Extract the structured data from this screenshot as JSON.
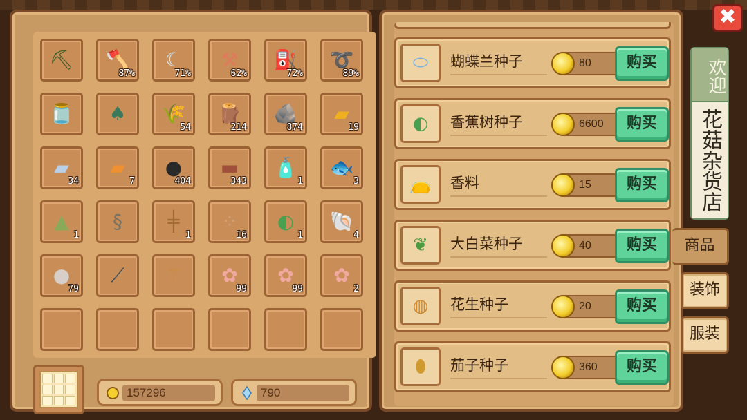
{
  "inventory": {
    "slots": [
      {
        "icon": "pickaxe-icon",
        "glyph": "⛏",
        "color": "#3b5a2a",
        "count": ""
      },
      {
        "icon": "axe-icon",
        "glyph": "🪓",
        "color": "#e07030",
        "count": "87%"
      },
      {
        "icon": "sickle-icon",
        "glyph": "☾",
        "color": "#d8e6f0",
        "count": "71%"
      },
      {
        "icon": "hoe-icon",
        "glyph": "⚒",
        "color": "#e07a5a",
        "count": "62%"
      },
      {
        "icon": "watering-can-icon",
        "glyph": "⛽",
        "color": "#7aa0b8",
        "count": "72%"
      },
      {
        "icon": "fishing-rod-icon",
        "glyph": "➰",
        "color": "#d08a40",
        "count": "89%"
      },
      {
        "icon": "glass-jar-icon",
        "glyph": "🫙",
        "color": "#c8d8e8",
        "count": ""
      },
      {
        "icon": "shovel-icon",
        "glyph": "♠",
        "color": "#3a7a5a",
        "count": ""
      },
      {
        "icon": "wheat-icon",
        "glyph": "🌾",
        "color": "#e8c030",
        "count": "54"
      },
      {
        "icon": "wood-log-icon",
        "glyph": "🪵",
        "color": "#7a5a2a",
        "count": "214"
      },
      {
        "icon": "stone-icon",
        "glyph": "🪨",
        "color": "#8a8a6a",
        "count": "874"
      },
      {
        "icon": "gold-bar-icon",
        "glyph": "▰",
        "color": "#f0b020",
        "count": "19"
      },
      {
        "icon": "iron-bar-icon",
        "glyph": "▰",
        "color": "#b8d0e8",
        "count": "34"
      },
      {
        "icon": "copper-bar-icon",
        "glyph": "▰",
        "color": "#f09030",
        "count": "7"
      },
      {
        "icon": "coal-icon",
        "glyph": "●",
        "color": "#2a2a2a",
        "count": "404"
      },
      {
        "icon": "brick-icon",
        "glyph": "▬",
        "color": "#a0503a",
        "count": "343"
      },
      {
        "icon": "bottle-icon",
        "glyph": "🧴",
        "color": "#d8e8f0",
        "count": "1"
      },
      {
        "icon": "fish-icon",
        "glyph": "🐟",
        "color": "#e0a030",
        "count": "3"
      },
      {
        "icon": "herb-icon",
        "glyph": "▲",
        "color": "#8aaa5a",
        "count": "1"
      },
      {
        "icon": "snake-icon",
        "glyph": "§",
        "color": "#7a7060",
        "count": ""
      },
      {
        "icon": "fence-icon",
        "glyph": "╪",
        "color": "#a06a30",
        "count": "1"
      },
      {
        "icon": "gravel-icon",
        "glyph": "⁘",
        "color": "#d0a078",
        "count": "16"
      },
      {
        "icon": "banana-seed-bag-icon",
        "glyph": "◐",
        "color": "#4aa050",
        "count": "1"
      },
      {
        "icon": "shell-icon",
        "glyph": "🐚",
        "color": "#6a8a30",
        "count": "4"
      },
      {
        "icon": "rock-icon",
        "glyph": "●",
        "color": "#d8d0c8",
        "count": "79"
      },
      {
        "icon": "crowbar-icon",
        "glyph": "⟋",
        "color": "#3a4a5a",
        "count": ""
      },
      {
        "icon": "scepter-icon",
        "glyph": "⚚",
        "color": "#d08a40",
        "count": ""
      },
      {
        "icon": "seed-packet-pink-icon",
        "glyph": "✿",
        "color": "#f0a8a0",
        "count": "99"
      },
      {
        "icon": "seed-packet-pink-icon",
        "glyph": "✿",
        "color": "#f0a8a0",
        "count": "99"
      },
      {
        "icon": "seed-packet-pink-icon",
        "glyph": "✿",
        "color": "#f0a8a0",
        "count": "2"
      },
      {
        "icon": "",
        "glyph": "",
        "color": "",
        "count": ""
      },
      {
        "icon": "",
        "glyph": "",
        "color": "",
        "count": ""
      },
      {
        "icon": "",
        "glyph": "",
        "color": "",
        "count": ""
      },
      {
        "icon": "",
        "glyph": "",
        "color": "",
        "count": ""
      },
      {
        "icon": "",
        "glyph": "",
        "color": "",
        "count": ""
      },
      {
        "icon": "",
        "glyph": "",
        "color": "",
        "count": ""
      }
    ]
  },
  "wallet": {
    "gold": "157296",
    "gems": "790"
  },
  "shop": {
    "items": [
      {
        "name": "蝴蝶兰种子",
        "price": "80",
        "icon": "orchid-seed-icon",
        "glyph": "⬭",
        "color": "#7ab0e0"
      },
      {
        "name": "香蕉树种子",
        "price": "6600",
        "icon": "banana-seed-icon",
        "glyph": "◐",
        "color": "#4aa050"
      },
      {
        "name": "香料",
        "price": "15",
        "icon": "spice-bag-icon",
        "glyph": "👝",
        "color": "#8a4a20"
      },
      {
        "name": "大白菜种子",
        "price": "40",
        "icon": "cabbage-seed-icon",
        "glyph": "❦",
        "color": "#4a9a40"
      },
      {
        "name": "花生种子",
        "price": "20",
        "icon": "peanut-seed-icon",
        "glyph": "◍",
        "color": "#d08a30"
      },
      {
        "name": "茄子种子",
        "price": "360",
        "icon": "eggplant-seed-icon",
        "glyph": "⬮",
        "color": "#d09a30"
      }
    ],
    "buy_label": "购买"
  },
  "sidebar": {
    "welcome": "欢迎",
    "shop_name": "花菇杂货店",
    "tabs": [
      "商品",
      "装饰",
      "服装"
    ]
  },
  "close_label": "✖"
}
